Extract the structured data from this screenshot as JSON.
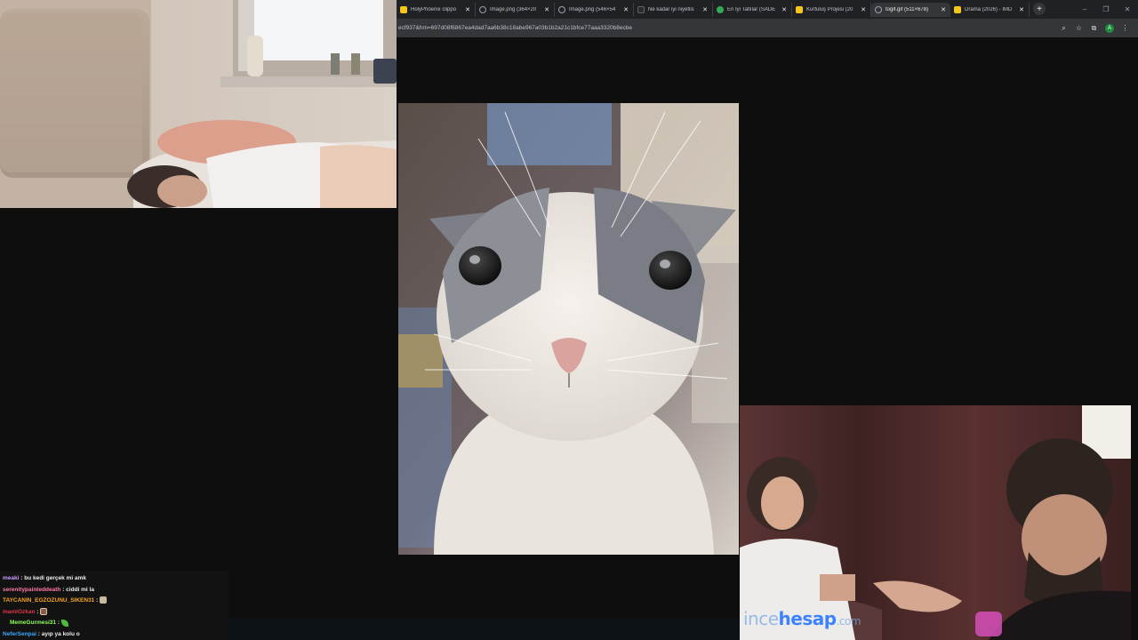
{
  "browser": {
    "tabs": [
      {
        "title": "HolyPhoenix clippo",
        "favicon": "holyphoenix-icon",
        "color": "#f5c518",
        "active": false
      },
      {
        "title": "Image.png (364×20",
        "favicon": "globe-icon",
        "color": "#9aa0a6",
        "active": false
      },
      {
        "title": "Image.png (546×54",
        "favicon": "globe-icon",
        "color": "#9aa0a6",
        "active": false
      },
      {
        "title": "Ne kadar iyi niyetlis",
        "favicon": "eksi-icon",
        "color": "#2b2b2b",
        "active": false
      },
      {
        "title": "En İyi Tatlılar (SADE",
        "favicon": "leaf-icon",
        "color": "#34a853",
        "active": false
      },
      {
        "title": "Kurtuluş Projesi (20",
        "favicon": "imdb-icon",
        "color": "#f5c518",
        "active": false
      },
      {
        "title": "togif.gif (511×678)",
        "favicon": "globe-icon",
        "color": "#9aa0a6",
        "active": true
      },
      {
        "title": "Drama (2026) - IMD",
        "favicon": "imdb-icon",
        "color": "#f5c518",
        "active": false
      }
    ],
    "url": "ecf937&hm=697d08f6867ea4dad7aa6b38c18abe967a03b1b2a21c1bfce77aaa3320b8ecbe",
    "window_buttons": [
      "–",
      "❐",
      "✕"
    ]
  },
  "overlay": {
    "logo_part1": "ince",
    "logo_part2": "hesap",
    "logo_part3": ".com",
    "accent": "#2878ff"
  },
  "chat": [
    {
      "user": "meaki",
      "color": "#c99cff",
      "text": "bu kedi gerçek mi amk",
      "emote": null
    },
    {
      "user": "serenitypainteddeath",
      "color": "#ff7aa8",
      "text": "ciddi mi la",
      "emote": null
    },
    {
      "user": "TAYCANIN_EGZOZUNU_SIKEN31",
      "color": "#f5a623",
      "text": "",
      "emote": "bag"
    },
    {
      "user": "mamiOzkan",
      "color": "#e0344a",
      "text": "",
      "emote": "frame"
    },
    {
      "user": "MemeGurmesi31",
      "color": "#8cff5a",
      "text": "",
      "emote": "leaf"
    },
    {
      "user": "NeferSenpai",
      "color": "#3ea6ff",
      "text": "ayıp ya kolu o",
      "emote": null
    }
  ]
}
